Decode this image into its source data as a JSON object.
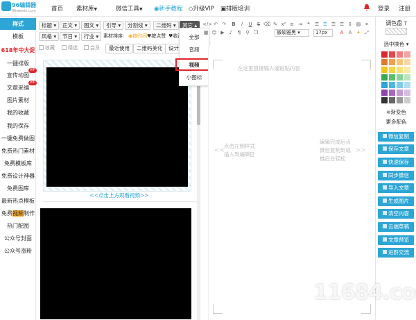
{
  "app": {
    "brand": "96编辑器",
    "brand_url": "96weixin.com"
  },
  "topnav": {
    "items": [
      "首页",
      "素材库",
      "微信工具",
      "新手教程",
      "升级VIP",
      "排版培训"
    ],
    "login": "登录",
    "register": "注册"
  },
  "sidebar": {
    "items": [
      "样式",
      "模板",
      "618年中大促",
      "一键排版",
      "宣传动图",
      "文章采编",
      "图片素材",
      "我的收藏",
      "我的保存",
      "一键免费做图",
      "免费热门素材",
      "免费模板库",
      "免费设计神器",
      "免费图库",
      "最新热点模板",
      "免费视频制作",
      "热门配图",
      "公众号封面",
      "公众号涨粉"
    ],
    "vip_badge": "VIP",
    "video_highlight": "视频"
  },
  "filters": {
    "row1": [
      "标题",
      "正文",
      "图文",
      "引导",
      "分割线",
      "二维码",
      "其它"
    ],
    "row2": [
      "风格",
      "节日",
      "行业"
    ],
    "sort_label": "素材排序:",
    "sort_options": [
      "按时间",
      "按点赞",
      "收藏量"
    ],
    "row3_checks": [
      "收藏",
      "精选",
      "会员"
    ],
    "row3_buttons": [
      "最近使用",
      "二维码美化",
      "设计师"
    ]
  },
  "dropdown": {
    "items": [
      "全部",
      "音频",
      "视频",
      "小图标"
    ]
  },
  "content": {
    "caption": "<<点击上方观看视频>>"
  },
  "editor": {
    "font_select": "微软雅黑",
    "size_select": "17px",
    "placeholder_top": "在这里直接输入或粘贴内容",
    "placeholder_left_1": "点击左侧样式",
    "placeholder_left_2": "插入到编辑区",
    "placeholder_right_1": "编辑完成后点",
    "placeholder_right_2": "微信复制到或",
    "placeholder_right_3": "推后台轻松"
  },
  "colorpanel": {
    "title": "调色盘",
    "select_label": "选中换色",
    "gradient": "渐变色",
    "more": "更多配色",
    "swatches": [
      "#e0262b",
      "#e5484d",
      "#f08080",
      "#f4a3a3",
      "#e07b2b",
      "#f0a050",
      "#f5c57a",
      "#f8d9a8",
      "#f0c419",
      "#f5d64a",
      "#f8e07a",
      "#faeaa8",
      "#3aa655",
      "#5cbf6a",
      "#89d497",
      "#b7e6c0",
      "#2da6d6",
      "#50b8e0",
      "#80cbe8",
      "#b0def2",
      "#8e44ad",
      "#a569bd",
      "#c39bd3",
      "#d7bde2",
      "#333333",
      "#666666",
      "#999999",
      "#cccccc"
    ],
    "buttons": [
      "微信复制",
      "保存文章",
      "快速保存",
      "同步微信",
      "导入文章",
      "生成图片",
      "清空内容",
      "云端草稿",
      "文章预览",
      "进群交流"
    ]
  },
  "watermark": "11684.com"
}
